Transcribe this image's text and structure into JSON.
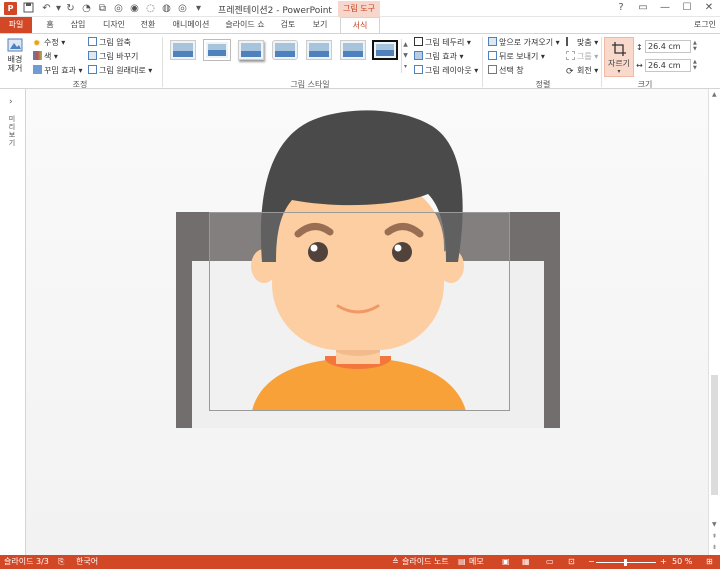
{
  "titlebar": {
    "app_icon": "P",
    "title": "프레젠테이션2 - PowerPoint",
    "context_tab": "그림 도구",
    "qat_icons": [
      "save-icon",
      "undo-icon",
      "redo-icon"
    ],
    "window_buttons": [
      "?",
      "▭",
      "—",
      "☐",
      "✕"
    ]
  },
  "tabs": {
    "file": "파일",
    "items": [
      "홈",
      "삽입",
      "디자인",
      "전환",
      "애니메이션",
      "슬라이드 쇼",
      "검토",
      "보기"
    ],
    "active": "서식",
    "login": "로그인"
  },
  "ribbon": {
    "adjust": {
      "remove_bg": "배경\n제거",
      "corrections": "수정 ▾",
      "color": "색 ▾",
      "artistic": "꾸밈 효과 ▾",
      "compress": "그림 압축",
      "change": "그림 바꾸기",
      "reset": "그림 원래대로 ▾",
      "label": "조정"
    },
    "styles": {
      "label": "그림 스타일",
      "border": "그림 테두리 ▾",
      "effects": "그림 효과 ▾",
      "layout": "그림 레이아웃 ▾"
    },
    "arrange": {
      "bring_forward": "앞으로 가져오기 ▾",
      "send_backward": "뒤로 보내기 ▾",
      "selection_pane": "선택 창",
      "align": "맞춤 ▾",
      "group": "그룹 ▾",
      "rotate": "회전 ▾",
      "label": "정렬"
    },
    "size": {
      "crop": "자르기",
      "height": "26.4 cm",
      "width": "26.4 cm",
      "label": "크기"
    }
  },
  "side_pane": {
    "label": "미리보기"
  },
  "statusbar": {
    "slide": "슬라이드 3/3",
    "language": "한국어",
    "notes": "슬라이드 노트",
    "comments": "메모",
    "zoom": "50 %"
  },
  "colors": {
    "accent": "#d24726",
    "hair": "#4a4a4a",
    "skin": "#fcc896",
    "shirt": "#f7941d",
    "collar": "#f26522",
    "slide_frame": "#726e6e"
  }
}
